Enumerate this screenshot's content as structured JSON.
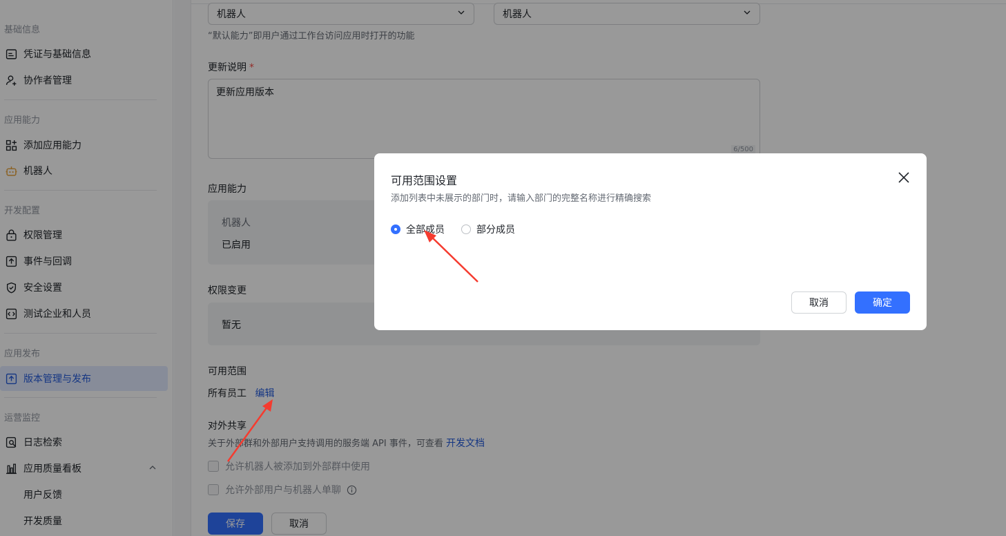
{
  "sidebar": {
    "groups": {
      "basic": "基础信息",
      "ability": "应用能力",
      "dev": "开发配置",
      "publish": "应用发布",
      "ops": "运营监控"
    },
    "items": {
      "credentials": "凭证与基础信息",
      "collaborators": "协作者管理",
      "add_ability": "添加应用能力",
      "robot": "机器人",
      "permissions": "权限管理",
      "events": "事件与回调",
      "security": "安全设置",
      "test_org": "测试企业和人员",
      "versions": "版本管理与发布",
      "logs": "日志检索",
      "quality_board": "应用质量看板",
      "feedback": "用户反馈",
      "dev_quality": "开发质量"
    }
  },
  "form": {
    "select_left": "机器人",
    "select_right": "机器人",
    "default_hint": "“默认能力”即用户通过工作台访问应用时打开的功能",
    "update_label": "更新说明",
    "required_mark": "*",
    "update_value": "更新应用版本",
    "update_counter": "6/500",
    "ability_label": "应用能力",
    "ability_name": "机器人",
    "ability_status": "已启用",
    "perm_label": "权限变更",
    "perm_value": "暂无",
    "scope_label": "可用范围",
    "scope_value": "所有员工",
    "scope_edit": "编辑",
    "share_label": "对外共享",
    "share_hint": "关于外部群和外部用户支持调用的服务端 API 事件，可查看",
    "share_link": "开发文档",
    "cb1": "允许机器人被添加到外部群中使用",
    "cb2": "允许外部用户与机器人单聊",
    "save": "保存",
    "cancel": "取消"
  },
  "modal": {
    "title": "可用范围设置",
    "subtitle": "添加列表中未展示的部门时，请输入部门的完整名称进行精确搜索",
    "radio_all": "全部成员",
    "radio_part": "部分成员",
    "selected": "全部成员",
    "cancel": "取消",
    "confirm": "确定"
  },
  "colors": {
    "primary": "#3370ff",
    "annotation_arrow": "#f53b2f"
  }
}
